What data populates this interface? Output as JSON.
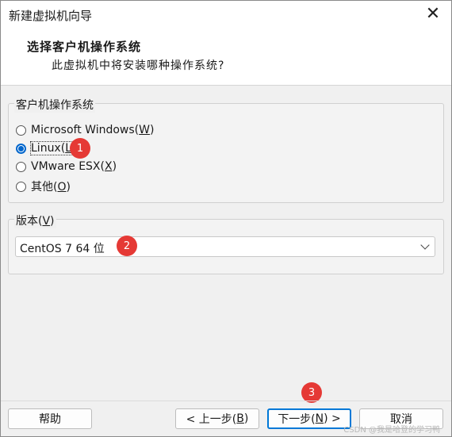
{
  "window": {
    "title": "新建虚拟机向导"
  },
  "header": {
    "title": "选择客户机操作系统",
    "subtitle": "此虚拟机中将安装哪种操作系统?"
  },
  "os_group": {
    "label": "客户机操作系统",
    "options": [
      {
        "label": "Microsoft Windows(",
        "key": "W",
        "suffix": ")",
        "checked": false
      },
      {
        "label": "Linux(",
        "key": "L",
        "suffix": ")",
        "checked": true
      },
      {
        "label": "VMware ESX(",
        "key": "X",
        "suffix": ")",
        "checked": false
      },
      {
        "label": "其他(",
        "key": "O",
        "suffix": ")",
        "checked": false
      }
    ]
  },
  "version_group": {
    "label_prefix": "版本(",
    "label_key": "V",
    "label_suffix": ")",
    "selected": "CentOS 7 64 位"
  },
  "markers": {
    "m1": "1",
    "m2": "2",
    "m3": "3"
  },
  "footer": {
    "help": "帮助",
    "back_prefix": "< 上一步(",
    "back_key": "B",
    "back_suffix": ")",
    "next_prefix": "下一步(",
    "next_key": "N",
    "next_suffix": ") >",
    "cancel": "取消"
  },
  "watermark": "CSDN @我是哈登的学习鸭",
  "colors": {
    "accent": "#0078d7",
    "marker": "#e53935"
  }
}
